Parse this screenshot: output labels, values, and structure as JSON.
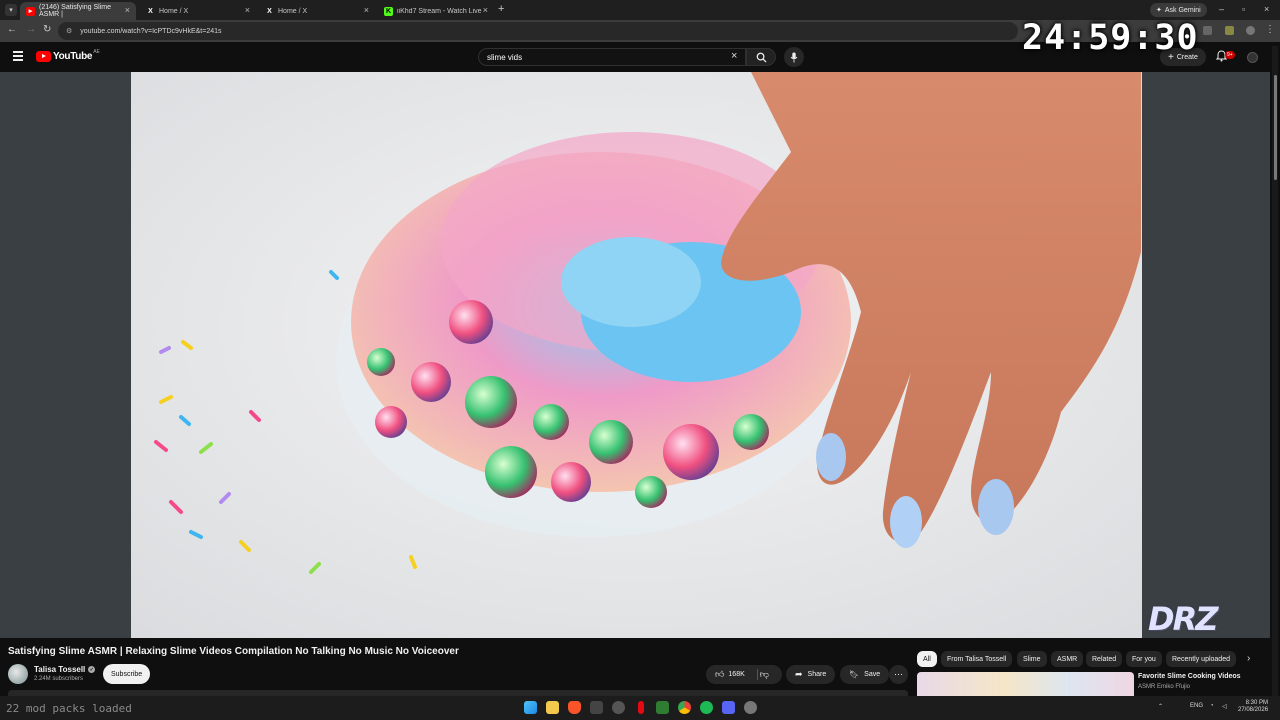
{
  "browser": {
    "tabs": [
      {
        "label": "(2146) Satisfying Slime ASMR |",
        "active": true,
        "favicon": "youtube-favicon"
      },
      {
        "label": "Home / X",
        "active": false,
        "favicon": "x-favicon"
      },
      {
        "label": "Home / X",
        "active": false,
        "favicon": "x-favicon"
      },
      {
        "label": "iiKhd7 Stream - Watch Live on",
        "active": false,
        "favicon": "kick-favicon"
      }
    ],
    "ask_gemini": "Ask Gemini",
    "url": "youtube.com/watch?v=IcPTDc9vHkE&t=241s"
  },
  "clock_overlay": "24:59:30",
  "youtube": {
    "logo_text": "YouTube",
    "country_code": "AE",
    "search_value": "slime vids",
    "create_label": "Create",
    "notification_count": "9+"
  },
  "video": {
    "title": "Satisfying Slime ASMR | Relaxing Slime Videos Compilation No Talking No Music No Voiceover",
    "channel_name": "Talisa Tossell",
    "subscribers": "2.24M subscribers",
    "subscribe_label": "Subscribe",
    "likes": "168K",
    "share_label": "Share",
    "save_label": "Save"
  },
  "chips": [
    "All",
    "From Talisa Tossell",
    "Slime",
    "ASMR",
    "Related",
    "For you",
    "Recently uploaded"
  ],
  "recommendation": {
    "title": "Favorite Slime Cooking Videos",
    "channel": "ASMR Emiko Ffujio"
  },
  "stream_overlay_logo": "DRZ",
  "taskbar": {
    "status_text": "22 mod packs loaded",
    "language": "ENG",
    "time": "8:30 PM",
    "date": "27/08/2026"
  },
  "colors": {
    "youtube_red": "#ff0000",
    "page_bg": "#0f0f0f",
    "chip_bg": "#272727",
    "video_letterbox": "#3a3f44"
  }
}
